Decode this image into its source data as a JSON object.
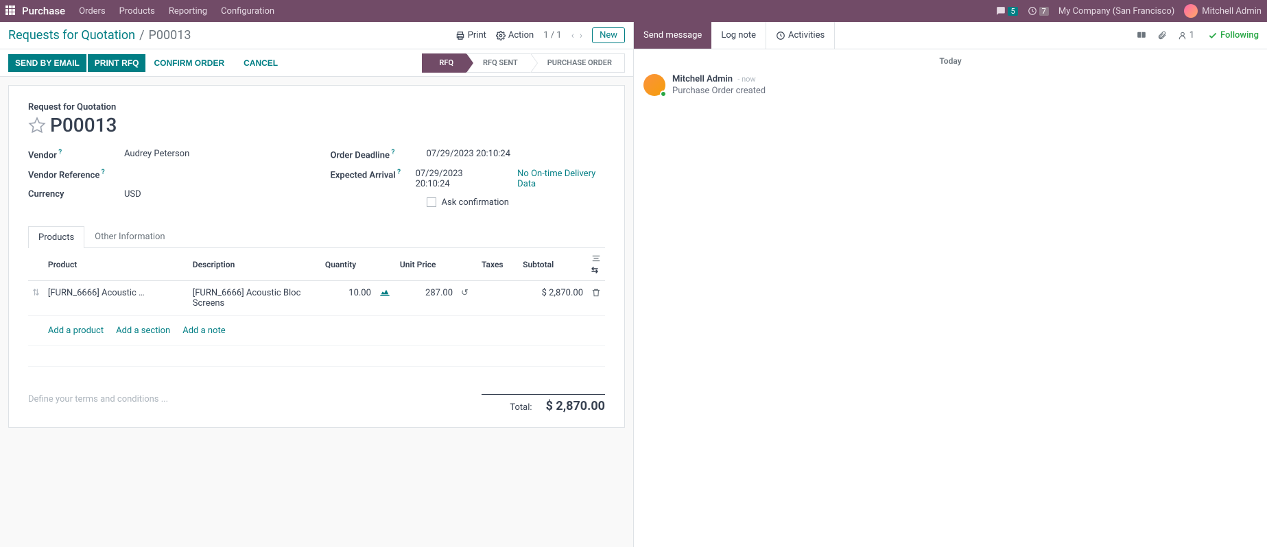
{
  "topnav": {
    "brand": "Purchase",
    "items": [
      "Orders",
      "Products",
      "Reporting",
      "Configuration"
    ],
    "chat_badge": "5",
    "clock_badge": "7",
    "company": "My Company (San Francisco)",
    "user": "Mitchell Admin"
  },
  "breadcrumb": {
    "root": "Requests for Quotation",
    "current": "P00013",
    "print": "Print",
    "action": "Action",
    "pager": "1 / 1",
    "new": "New"
  },
  "statusbar": {
    "send_email": "SEND BY EMAIL",
    "print_rfq": "PRINT RFQ",
    "confirm": "CONFIRM ORDER",
    "cancel": "CANCEL",
    "stages": [
      "RFQ",
      "RFQ SENT",
      "PURCHASE ORDER"
    ]
  },
  "form": {
    "subtitle": "Request for Quotation",
    "name": "P00013",
    "labels": {
      "vendor": "Vendor",
      "vendor_ref": "Vendor Reference",
      "currency": "Currency",
      "deadline": "Order Deadline",
      "arrival": "Expected Arrival",
      "ask_confirm": "Ask confirmation"
    },
    "vendor": "Audrey Peterson",
    "vendor_ref": "",
    "currency": "USD",
    "deadline": "07/29/2023 20:10:24",
    "arrival": "07/29/2023 20:10:24",
    "no_data": "No On-time Delivery Data"
  },
  "tabs": {
    "products": "Products",
    "other": "Other Information"
  },
  "table": {
    "headers": {
      "product": "Product",
      "description": "Description",
      "quantity": "Quantity",
      "unit_price": "Unit Price",
      "taxes": "Taxes",
      "subtotal": "Subtotal"
    },
    "rows": [
      {
        "product": "[FURN_6666] Acoustic …",
        "description": "[FURN_6666] Acoustic Bloc Screens",
        "quantity": "10.00",
        "unit_price": "287.00",
        "taxes": "",
        "subtotal": "$ 2,870.00"
      }
    ],
    "add_product": "Add a product",
    "add_section": "Add a section",
    "add_note": "Add a note"
  },
  "terms_placeholder": "Define your terms and conditions ...",
  "totals": {
    "label": "Total:",
    "value": "$ 2,870.00"
  },
  "chatter": {
    "send": "Send message",
    "log": "Log note",
    "activities": "Activities",
    "followers": "1",
    "following": "Following",
    "day": "Today",
    "msg": {
      "author": "Mitchell Admin",
      "time": "now",
      "body": "Purchase Order created"
    }
  }
}
